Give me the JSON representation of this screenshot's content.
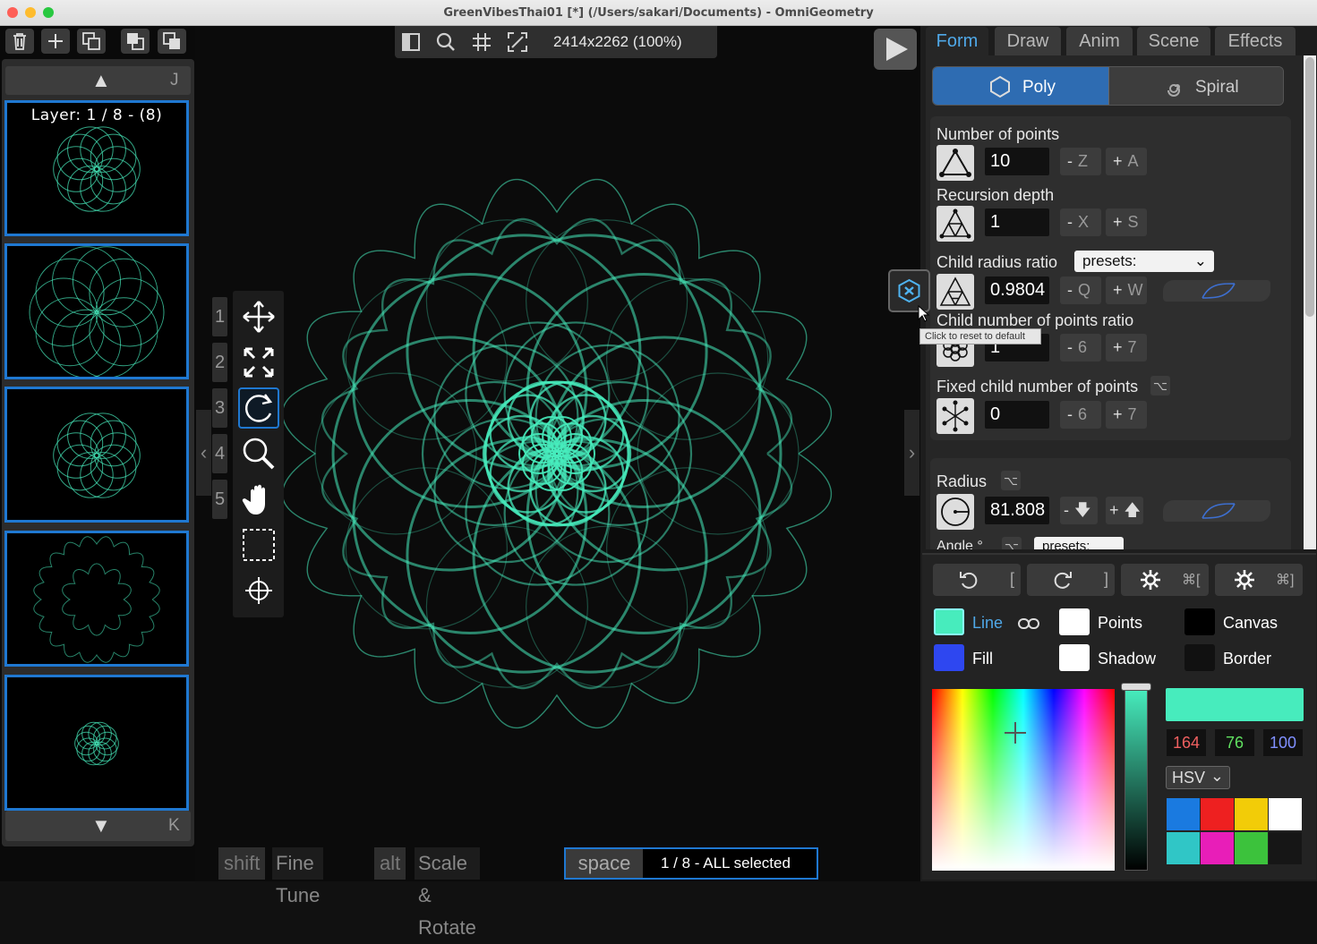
{
  "window": {
    "title": "GreenVibesThai01 [*] (/Users/sakari/Documents) - OmniGeometry"
  },
  "layers": {
    "label": "Layer: 1 / 8 - (8)",
    "up_key": "J",
    "down_key": "K"
  },
  "view": {
    "dimensions": "2414x2262 (100%)"
  },
  "tools": {
    "numbers": [
      "1",
      "2",
      "3",
      "4",
      "5"
    ]
  },
  "tooltip": "Click to reset to default",
  "status": {
    "shift": "shift",
    "shift_label": "Fine Tune",
    "alt": "alt",
    "alt_label": "Scale & Rotate",
    "space": "space",
    "selection": "1 / 8 - ALL selected"
  },
  "tabs": [
    "Form",
    "Draw",
    "Anim",
    "Scene",
    "Effects"
  ],
  "form": {
    "poly_label": "Poly",
    "spiral_label": "Spiral",
    "num_points": {
      "label": "Number of points",
      "value": "10",
      "minus_key": "Z",
      "plus_key": "A"
    },
    "recursion": {
      "label": "Recursion depth",
      "value": "1",
      "minus_key": "X",
      "plus_key": "S"
    },
    "child_radius": {
      "label": "Child radius ratio",
      "value": "0.9804",
      "minus_key": "Q",
      "plus_key": "W",
      "presets": "presets:"
    },
    "child_points": {
      "label": "Child number of points ratio",
      "value": "1",
      "minus_key": "6",
      "plus_key": "7"
    },
    "fixed_child": {
      "label": "Fixed child number of points",
      "value": "0",
      "minus_key": "6",
      "plus_key": "7"
    },
    "radius": {
      "label": "Radius",
      "value": "81.808"
    },
    "angle": {
      "label": "Angle °",
      "presets": "presets:"
    }
  },
  "color": {
    "rotate_left_key": "[",
    "rotate_right_key": "]",
    "gear1_key": "⌘[",
    "gear2_key": "⌘]",
    "line_label": "Line",
    "fill_label": "Fill",
    "points_label": "Points",
    "shadow_label": "Shadow",
    "canvas_label": "Canvas",
    "border_label": "Border",
    "h": "164",
    "s": "76",
    "v": "100",
    "mode": "HSV",
    "line_color": "#47ecbd",
    "fill_color": "#2e47f0",
    "palette": [
      "#1a7ae0",
      "#ee2020",
      "#f2cc08",
      "#ffffff",
      "#30c6c6",
      "#e81eb8",
      "#3cc23c",
      "#161616"
    ]
  }
}
